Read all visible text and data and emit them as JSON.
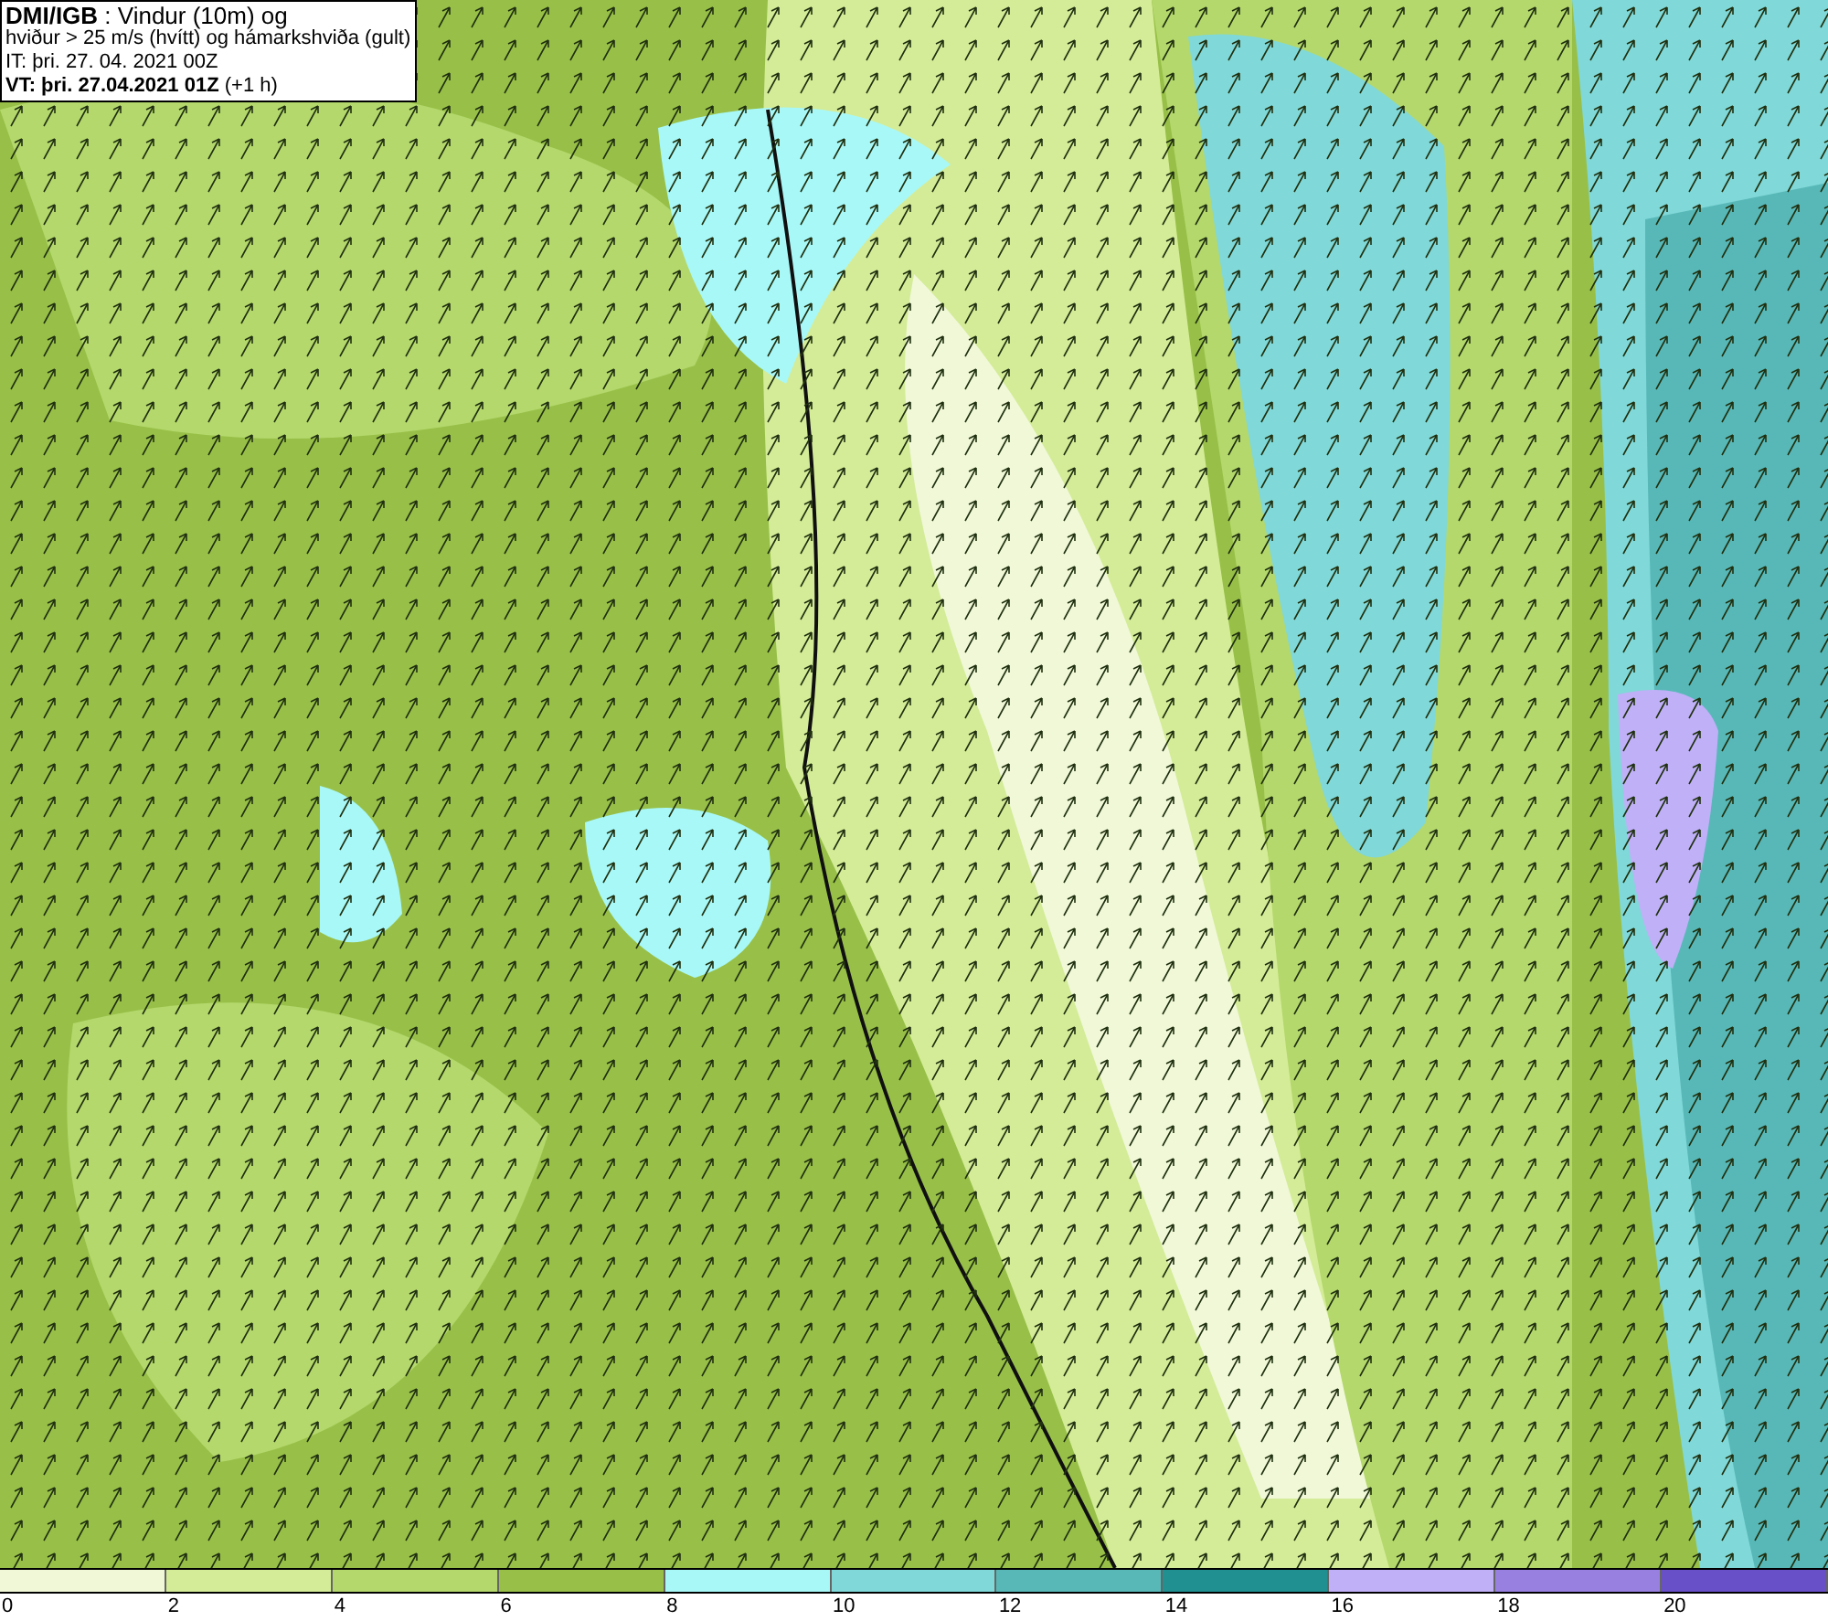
{
  "info_box": {
    "lines": [
      "**DMI/IGB** : Vindur (10m) og",
      "hviður > 25 m/s (hvítt) og hámarkshviða (gult)",
      "IT: þri. 27. 04. 2021 00Z",
      "**VT: þri. 27.04.2021 01Z** (+1 h)"
    ]
  },
  "legend": {
    "bins": [
      {
        "color": "#f0f8d8"
      },
      {
        "color": "#d4ec98"
      },
      {
        "color": "#b4d86c"
      },
      {
        "color": "#98c048"
      },
      {
        "color": "#a8f8f8"
      },
      {
        "color": "#80d8d8"
      },
      {
        "color": "#58b8b8"
      },
      {
        "color": "#209090"
      },
      {
        "color": "#c0b0f8"
      },
      {
        "color": "#9880e0"
      },
      {
        "color": "#6850c8"
      }
    ],
    "labels": [
      "0",
      "2",
      "4",
      "6",
      "8",
      "10",
      "12",
      "14",
      "16",
      "18",
      "20"
    ]
  }
}
